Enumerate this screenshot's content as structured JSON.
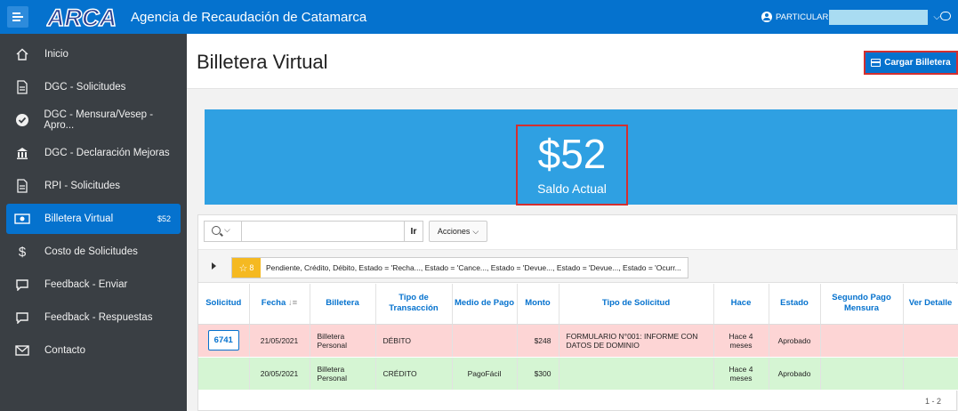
{
  "header": {
    "logo_text": "ARCA",
    "app_title": "Agencia de Recaudación de Catamarca",
    "user_label": "PARTICULAR"
  },
  "sidebar": {
    "items": [
      {
        "label": "Inicio",
        "icon": "home-icon"
      },
      {
        "label": "DGC - Solicitudes",
        "icon": "document-icon"
      },
      {
        "label": "DGC - Mensura/Vesep - Apro...",
        "icon": "check-circle-icon"
      },
      {
        "label": "DGC - Declaración Mejoras",
        "icon": "building-icon"
      },
      {
        "label": "RPI - Solicitudes",
        "icon": "document-icon"
      },
      {
        "label": "Billetera Virtual",
        "icon": "money-icon",
        "badge": "$52",
        "active": true
      },
      {
        "label": "Costo de Solicitudes",
        "icon": "dollar-icon"
      },
      {
        "label": "Feedback - Enviar",
        "icon": "chat-icon"
      },
      {
        "label": "Feedback - Respuestas",
        "icon": "chat-icon"
      },
      {
        "label": "Contacto",
        "icon": "mail-icon"
      }
    ]
  },
  "page": {
    "title": "Billetera Virtual",
    "cargar_button": "Cargar Billetera"
  },
  "balance": {
    "amount": "$52",
    "label": "Saldo Actual"
  },
  "report": {
    "search_value": "",
    "ir_button": "Ir",
    "acciones_button": "Acciones",
    "filter_count": "8",
    "filter_text": "Pendiente, Crédito, Débito, Estado = 'Recha..., Estado = 'Cance..., Estado = 'Devue..., Estado = 'Devue..., Estado = 'Ocurr...",
    "columns": [
      "Solicitud",
      "Fecha",
      "Billetera",
      "Tipo de Transacción",
      "Medio de Pago",
      "Monto",
      "Tipo de Solicitud",
      "Hace",
      "Estado",
      "Segundo Pago Mensura",
      "Ver Detalle"
    ],
    "rows": [
      {
        "solicitud": "6741",
        "fecha": "21/05/2021",
        "billetera": "Billetera Personal",
        "tipo": "DÉBITO",
        "medio": "",
        "monto": "$248",
        "tipo_solicitud": "FORMULARIO N°001: INFORME CON DATOS DE DOMINIO",
        "hace": "Hace 4 meses",
        "estado": "Aprobado",
        "segundo_pago": "",
        "ver_detalle": ""
      },
      {
        "solicitud": "",
        "fecha": "20/05/2021",
        "billetera": "Billetera Personal",
        "tipo": "CRÉDITO",
        "medio": "PagoFácil",
        "monto": "$300",
        "tipo_solicitud": "",
        "hace": "Hace 4 meses",
        "estado": "Aprobado",
        "segundo_pago": "",
        "ver_detalle": ""
      }
    ],
    "pagination": "1 - 2"
  },
  "colors": {
    "brand_blue": "#0572ce",
    "hero_blue": "#2fa0e2",
    "sidebar_bg": "#3a3f44",
    "highlight_red": "#d32f2f",
    "debit_row": "#fdd5d5",
    "credit_row": "#d5f5d3",
    "filter_badge": "#f5b921"
  }
}
